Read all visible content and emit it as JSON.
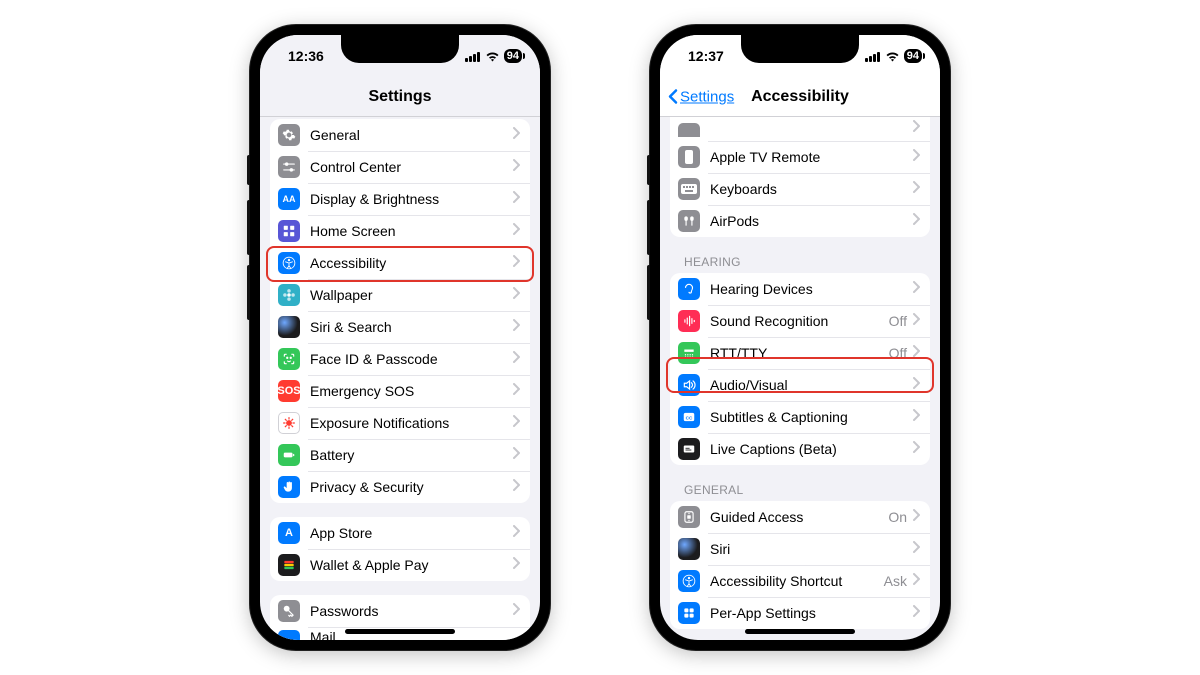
{
  "phones": [
    {
      "status": {
        "time": "12:36",
        "battery": "94"
      },
      "title": "Settings",
      "back": null,
      "highlightIndex": 4,
      "sections": [
        {
          "header": null,
          "rows": [
            {
              "icon": "gear-icon",
              "iconClass": "ic-grey",
              "label": "General",
              "value": ""
            },
            {
              "icon": "toggles-icon",
              "iconClass": "ic-grey",
              "label": "Control Center",
              "value": ""
            },
            {
              "icon": "text-size-icon",
              "iconClass": "ic-blue",
              "glyph": "AA",
              "label": "Display & Brightness",
              "value": ""
            },
            {
              "icon": "grid-icon",
              "iconClass": "ic-purple",
              "label": "Home Screen",
              "value": ""
            },
            {
              "icon": "accessibility-icon",
              "iconClass": "ic-blue",
              "label": "Accessibility",
              "value": ""
            },
            {
              "icon": "flower-icon",
              "iconClass": "ic-teal",
              "label": "Wallpaper",
              "value": ""
            },
            {
              "icon": "siri-icon",
              "iconClass": "ic-siri",
              "label": "Siri & Search",
              "value": ""
            },
            {
              "icon": "faceid-icon",
              "iconClass": "ic-green",
              "label": "Face ID & Passcode",
              "value": ""
            },
            {
              "icon": "sos-icon",
              "iconClass": "ic-sos",
              "glyph": "SOS",
              "label": "Emergency SOS",
              "value": ""
            },
            {
              "icon": "virus-icon",
              "iconClass": "ic-white",
              "label": "Exposure Notifications",
              "value": ""
            },
            {
              "icon": "battery-icon",
              "iconClass": "ic-green",
              "label": "Battery",
              "value": ""
            },
            {
              "icon": "hand-icon",
              "iconClass": "ic-blue",
              "label": "Privacy & Security",
              "value": ""
            }
          ]
        },
        {
          "header": null,
          "rows": [
            {
              "icon": "appstore-icon",
              "iconClass": "ic-blue",
              "glyph": "A",
              "label": "App Store",
              "value": ""
            },
            {
              "icon": "wallet-icon",
              "iconClass": "ic-black",
              "label": "Wallet & Apple Pay",
              "value": ""
            }
          ]
        },
        {
          "header": null,
          "rows": [
            {
              "icon": "key-icon",
              "iconClass": "ic-grey",
              "label": "Passwords",
              "value": ""
            },
            {
              "icon": "mail-icon",
              "iconClass": "ic-blue",
              "label": "Mail",
              "value": "",
              "partial": true
            }
          ]
        }
      ]
    },
    {
      "status": {
        "time": "12:37",
        "battery": "94"
      },
      "title": "Accessibility",
      "back": "Settings",
      "highlightIndex": 7,
      "sections": [
        {
          "header": null,
          "partialTop": true,
          "rows": [
            {
              "icon": "unknown-icon",
              "iconClass": "ic-grey",
              "label": " ",
              "value": "",
              "partialTop": true
            },
            {
              "icon": "tvremote-icon",
              "iconClass": "ic-grey",
              "label": "Apple TV Remote",
              "value": ""
            },
            {
              "icon": "keyboard-icon",
              "iconClass": "ic-grey",
              "label": "Keyboards",
              "value": ""
            },
            {
              "icon": "airpods-icon",
              "iconClass": "ic-grey",
              "label": "AirPods",
              "value": ""
            }
          ]
        },
        {
          "header": "HEARING",
          "rows": [
            {
              "icon": "ear-icon",
              "iconClass": "ic-blue",
              "label": "Hearing Devices",
              "value": ""
            },
            {
              "icon": "sound-icon",
              "iconClass": "ic-pink",
              "label": "Sound Recognition",
              "value": "Off"
            },
            {
              "icon": "rtt-icon",
              "iconClass": "ic-green",
              "label": "RTT/TTY",
              "value": "Off"
            },
            {
              "icon": "audio-icon",
              "iconClass": "ic-blue",
              "label": "Audio/Visual",
              "value": ""
            },
            {
              "icon": "captions-icon",
              "iconClass": "ic-blue",
              "label": "Subtitles & Captioning",
              "value": ""
            },
            {
              "icon": "livecap-icon",
              "iconClass": "ic-black",
              "label": "Live Captions (Beta)",
              "value": ""
            }
          ]
        },
        {
          "header": "GENERAL",
          "rows": [
            {
              "icon": "guided-icon",
              "iconClass": "ic-grey",
              "label": "Guided Access",
              "value": "On"
            },
            {
              "icon": "siri2-icon",
              "iconClass": "ic-siri",
              "label": "Siri",
              "value": ""
            },
            {
              "icon": "shortcut-icon",
              "iconClass": "ic-blue",
              "label": "Accessibility Shortcut",
              "value": "Ask"
            },
            {
              "icon": "perapp-icon",
              "iconClass": "ic-blue",
              "label": "Per-App Settings",
              "value": ""
            }
          ]
        }
      ]
    }
  ]
}
